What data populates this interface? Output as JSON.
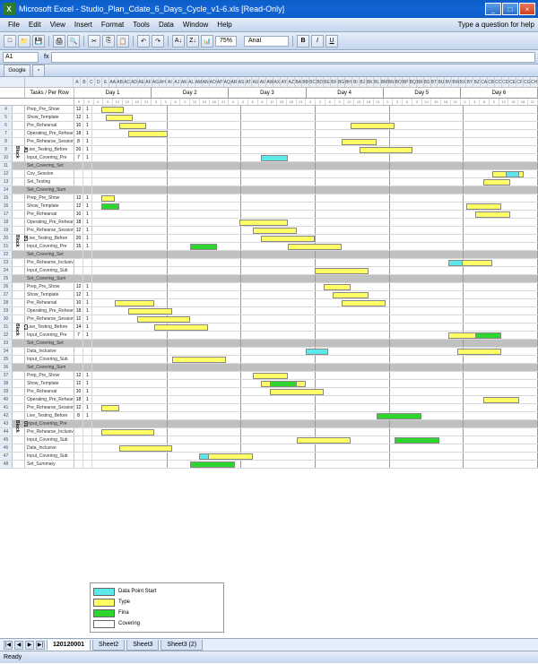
{
  "window": {
    "app": "Microsoft Excel",
    "file": "Studio_Plan_Cdate_6_Days_Cycle_v1-6.xls",
    "mode": "[Read-Only]"
  },
  "menus": [
    "File",
    "Edit",
    "View",
    "Insert",
    "Format",
    "Tools",
    "Data",
    "Window",
    "Help"
  ],
  "help_prompt": "Type a question for help",
  "toolbar": {
    "zoom": "75%",
    "font": "Arial"
  },
  "namebox": "A1",
  "days": [
    "Day 1",
    "Day 2",
    "Day 3",
    "Day 4",
    "Day 5",
    "Day 6"
  ],
  "header_label": "Tasks / Per Row",
  "blocks": [
    {
      "name": "Block A1",
      "tasks": [
        {
          "name": "Prep_Pre_Show",
          "dur": "12",
          "bars": [
            {
              "c": "yellow",
              "s": 2,
              "e": 7
            }
          ]
        },
        {
          "name": "Show_Template",
          "dur": "12",
          "bars": [
            {
              "c": "yellow",
              "s": 3,
              "e": 9
            }
          ]
        },
        {
          "name": "Pre_Rehearsal",
          "dur": "10",
          "bars": [
            {
              "c": "yellow",
              "s": 6,
              "e": 12
            },
            {
              "c": "yellow",
              "s": 58,
              "e": 68
            }
          ]
        },
        {
          "name": "Operating_Pre_Rehearse",
          "dur": "18",
          "bars": [
            {
              "c": "yellow",
              "s": 8,
              "e": 17
            }
          ]
        },
        {
          "name": "Pre_Rehearse_Session",
          "dur": "8",
          "bars": [
            {
              "c": "yellow",
              "s": 56,
              "e": 64
            }
          ]
        },
        {
          "name": "Live_Testing_Before",
          "dur": "20",
          "bars": [
            {
              "c": "yellow",
              "s": 60,
              "e": 72
            }
          ]
        },
        {
          "name": "Input_Covering_Pre",
          "dur": "7",
          "bars": [
            {
              "c": "cyan",
              "s": 38,
              "e": 44
            }
          ]
        },
        {
          "name": "Set_Covering_Set",
          "dur": "",
          "bars": [],
          "summary": true
        },
        {
          "name": "Cov_Session",
          "dur": "",
          "bars": [
            {
              "c": "yellow",
              "s": 90,
              "e": 97
            },
            {
              "c": "cyan",
              "s": 93,
              "e": 96
            }
          ]
        },
        {
          "name": "Set_Testing",
          "dur": "",
          "bars": [
            {
              "c": "yellow",
              "s": 88,
              "e": 94
            }
          ]
        },
        {
          "name": "Set_Covering_Sum",
          "dur": "",
          "bars": [],
          "summary": true
        }
      ]
    },
    {
      "name": "Block B1",
      "tasks": [
        {
          "name": "Prep_Pre_Show",
          "dur": "12",
          "bars": [
            {
              "c": "yellow",
              "s": 2,
              "e": 5
            }
          ]
        },
        {
          "name": "Show_Template",
          "dur": "12",
          "bars": [
            {
              "c": "green",
              "s": 2,
              "e": 6
            },
            {
              "c": "yellow",
              "s": 84,
              "e": 92
            }
          ]
        },
        {
          "name": "Pre_Rehearsal",
          "dur": "10",
          "bars": [
            {
              "c": "yellow",
              "s": 86,
              "e": 94
            }
          ]
        },
        {
          "name": "Operating_Pre_Rehearse",
          "dur": "18",
          "bars": [
            {
              "c": "yellow",
              "s": 33,
              "e": 44
            }
          ]
        },
        {
          "name": "Pre_Rehearse_Session",
          "dur": "12",
          "bars": [
            {
              "c": "yellow",
              "s": 36,
              "e": 46
            }
          ]
        },
        {
          "name": "Live_Testing_Before",
          "dur": "20",
          "bars": [
            {
              "c": "yellow",
              "s": 38,
              "e": 50
            }
          ]
        },
        {
          "name": "Input_Covering_Pre",
          "dur": "15",
          "bars": [
            {
              "c": "green",
              "s": 22,
              "e": 28
            },
            {
              "c": "yellow",
              "s": 44,
              "e": 56
            }
          ]
        },
        {
          "name": "Set_Covering_Set",
          "dur": "",
          "bars": [],
          "summary": true
        },
        {
          "name": "Pre_Rehearse_Inclusive",
          "dur": "",
          "bars": [
            {
              "c": "cyan",
              "s": 80,
              "e": 85
            },
            {
              "c": "yellow",
              "s": 83,
              "e": 90
            }
          ]
        },
        {
          "name": "Input_Covering_Sub",
          "dur": "",
          "bars": [
            {
              "c": "yellow",
              "s": 50,
              "e": 62
            }
          ]
        },
        {
          "name": "Set_Covering_Sum",
          "dur": "",
          "bars": [],
          "summary": true
        }
      ]
    },
    {
      "name": "Block C1",
      "tasks": [
        {
          "name": "Prep_Pre_Show",
          "dur": "12",
          "bars": [
            {
              "c": "yellow",
              "s": 52,
              "e": 58
            }
          ]
        },
        {
          "name": "Show_Template",
          "dur": "12",
          "bars": [
            {
              "c": "yellow",
              "s": 54,
              "e": 62
            }
          ]
        },
        {
          "name": "Pre_Rehearsal",
          "dur": "10",
          "bars": [
            {
              "c": "yellow",
              "s": 5,
              "e": 14
            },
            {
              "c": "yellow",
              "s": 56,
              "e": 66
            }
          ]
        },
        {
          "name": "Operating_Pre_Rehearse",
          "dur": "18",
          "bars": [
            {
              "c": "yellow",
              "s": 8,
              "e": 18
            }
          ]
        },
        {
          "name": "Pre_Rehearse_Session",
          "dur": "12",
          "bars": [
            {
              "c": "yellow",
              "s": 10,
              "e": 22
            }
          ]
        },
        {
          "name": "Live_Testing_Before",
          "dur": "14",
          "bars": [
            {
              "c": "yellow",
              "s": 14,
              "e": 26
            }
          ]
        },
        {
          "name": "Input_Covering_Pre",
          "dur": "7",
          "bars": [
            {
              "c": "yellow",
              "s": 80,
              "e": 90
            },
            {
              "c": "green",
              "s": 86,
              "e": 92
            }
          ]
        },
        {
          "name": "Set_Covering_Set",
          "dur": "",
          "bars": [],
          "summary": true
        },
        {
          "name": "Data_Inclusive",
          "dur": "",
          "bars": [
            {
              "c": "cyan",
              "s": 48,
              "e": 53
            },
            {
              "c": "yellow",
              "s": 82,
              "e": 92
            }
          ]
        },
        {
          "name": "Input_Covering_Sub",
          "dur": "",
          "bars": [
            {
              "c": "yellow",
              "s": 18,
              "e": 30
            }
          ]
        },
        {
          "name": "Set_Covering_Sum",
          "dur": "",
          "bars": [],
          "summary": true
        }
      ]
    },
    {
      "name": "Block D1",
      "tasks": [
        {
          "name": "Prep_Pre_Show",
          "dur": "12",
          "bars": [
            {
              "c": "yellow",
              "s": 36,
              "e": 44
            }
          ]
        },
        {
          "name": "Show_Template",
          "dur": "12",
          "bars": [
            {
              "c": "yellow",
              "s": 38,
              "e": 48
            },
            {
              "c": "green",
              "s": 40,
              "e": 46
            }
          ]
        },
        {
          "name": "Pre_Rehearsal",
          "dur": "10",
          "bars": [
            {
              "c": "yellow",
              "s": 40,
              "e": 52
            }
          ]
        },
        {
          "name": "Operating_Pre_Rehearse",
          "dur": "18",
          "bars": [
            {
              "c": "yellow",
              "s": 88,
              "e": 96
            }
          ]
        },
        {
          "name": "Pre_Rehearse_Session",
          "dur": "12",
          "bars": [
            {
              "c": "yellow",
              "s": 2,
              "e": 6
            }
          ]
        },
        {
          "name": "Live_Testing_Before",
          "dur": "8",
          "bars": [
            {
              "c": "green",
              "s": 64,
              "e": 74
            }
          ]
        },
        {
          "name": "Input_Covering_Pre",
          "dur": "",
          "bars": [],
          "summary": true
        },
        {
          "name": "Pre_Rehearse_Inclusive",
          "dur": "",
          "bars": [
            {
              "c": "yellow",
              "s": 2,
              "e": 14
            }
          ]
        },
        {
          "name": "Input_Covering_Sub",
          "dur": "",
          "bars": [
            {
              "c": "yellow",
              "s": 46,
              "e": 58
            },
            {
              "c": "green",
              "s": 68,
              "e": 78
            }
          ]
        },
        {
          "name": "Data_Inclusive",
          "dur": "",
          "bars": [
            {
              "c": "yellow",
              "s": 6,
              "e": 18
            }
          ]
        },
        {
          "name": "Input_Covering_Sub",
          "dur": "",
          "bars": [
            {
              "c": "cyan",
              "s": 24,
              "e": 29
            },
            {
              "c": "yellow",
              "s": 26,
              "e": 36
            }
          ]
        },
        {
          "name": "Set_Summary",
          "dur": "",
          "bars": [
            {
              "c": "green",
              "s": 22,
              "e": 32
            }
          ]
        }
      ]
    }
  ],
  "legend": [
    {
      "color": "#5be8e8",
      "label": "Data Point Start"
    },
    {
      "color": "#ffff66",
      "label": "Type"
    },
    {
      "color": "#2dd62d",
      "label": "Fina"
    },
    {
      "color": "#ffffff",
      "label": "Covering"
    }
  ],
  "sheets": [
    "120120001",
    "Sheet2",
    "Sheet3",
    "Sheet3 (2)"
  ],
  "status": "Ready",
  "colheads": [
    "A",
    "B",
    "C",
    "D",
    "E",
    "AA",
    "AB",
    "AC",
    "AD",
    "AE",
    "AF",
    "AG",
    "AH",
    "AI",
    "AJ",
    "AK",
    "AL",
    "AM",
    "AN",
    "AO",
    "AP",
    "AQ",
    "AR",
    "AS",
    "AT",
    "AU",
    "AV",
    "AW",
    "AX",
    "AY",
    "AZ",
    "BA",
    "BB",
    "BC",
    "BD",
    "BE",
    "BF",
    "BG",
    "BH",
    "BI",
    "BJ",
    "BK",
    "BL",
    "BM",
    "BN",
    "BO",
    "BP",
    "BQ",
    "BR",
    "BS",
    "BT",
    "BU",
    "BV",
    "BW",
    "BX",
    "BY",
    "BZ",
    "CA",
    "CB",
    "CC",
    "CD",
    "CE",
    "CF",
    "CG",
    "CH"
  ]
}
